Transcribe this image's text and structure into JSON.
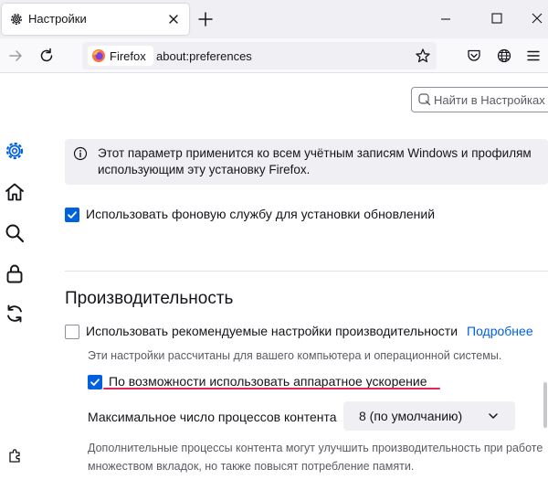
{
  "tab": {
    "title": "Настройки"
  },
  "urlbar": {
    "identity_label": "Firefox",
    "url": "about:preferences"
  },
  "search": {
    "placeholder": "Найти в Настройках"
  },
  "info": {
    "line1": "Этот параметр применится ко всем учётным записям Windows и профилям",
    "line2": "использующим эту установку Firefox."
  },
  "background_service": {
    "label": "Использовать фоновую службу для установки обновлений",
    "checked": true
  },
  "performance": {
    "title": "Производительность",
    "recommended_label": "Использовать рекомендуемые настройки производительности",
    "recommended_checked": false,
    "learn_more": "Подробнее",
    "recommended_desc": "Эти настройки рассчитаны для вашего компьютера и операционной системы.",
    "hw_accel_label": "По возможности использовать аппаратное ускорение",
    "hw_accel_checked": true,
    "process_label": "Максимальное число процессов контента",
    "process_value": "8 (по умолчанию)",
    "process_desc_line1": "Дополнительные процессы контента могут улучшить производительность при работе",
    "process_desc_line2": "множеством вкладок, но также повысят потребление памяти."
  },
  "icons": {
    "tab": "gear-icon",
    "close": "close-icon",
    "new_tab": "plus-icon",
    "forward": "arrow-right-icon",
    "reload": "reload-icon",
    "bookmark": "star-icon",
    "pocket": "pocket-icon",
    "globe": "globe-icon",
    "menu": "hamburger-icon",
    "sidebar": [
      "gear-icon",
      "home-icon",
      "search-icon",
      "lock-icon",
      "sync-icon",
      "extensions-icon"
    ]
  },
  "colors": {
    "accent": "#0061e0",
    "annotation": "#e22850"
  }
}
